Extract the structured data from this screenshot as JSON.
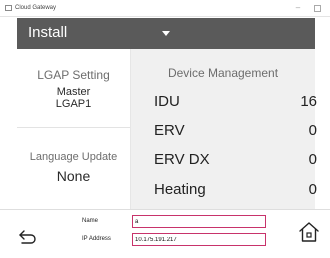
{
  "window": {
    "title": "Cloud Gateway",
    "minimize_glyph": "–"
  },
  "header": {
    "menu_label": "Install"
  },
  "lgap": {
    "title": "LGAP Setting",
    "role": "Master",
    "name": "LGAP1"
  },
  "language": {
    "title": "Language Update",
    "status": "None"
  },
  "device_management": {
    "title": "Device Management",
    "rows": [
      {
        "label": "IDU",
        "count": "16"
      },
      {
        "label": "ERV",
        "count": "0"
      },
      {
        "label": "ERV DX",
        "count": "0"
      },
      {
        "label": "Heating",
        "count": "0"
      }
    ]
  },
  "footer": {
    "name_label": "Name",
    "name_value": "a",
    "ip_label": "IP Address",
    "ip_value": "10.175.191.217"
  },
  "icons": {
    "back": "back-arrow-icon",
    "home": "home-icon"
  }
}
